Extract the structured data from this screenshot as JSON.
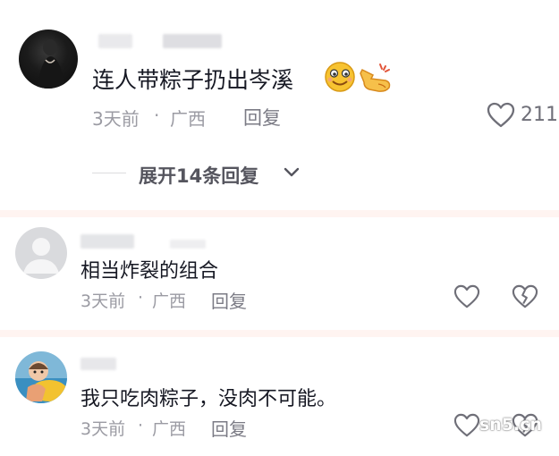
{
  "comments": [
    {
      "text": "连人带粽子扔出岑溪",
      "time": "3天前",
      "location": "广西",
      "reply_label": "回复",
      "like_count": "211",
      "expand_label": "展开14条回复"
    },
    {
      "text": "相当炸裂的组合",
      "time": "3天前",
      "location": "广西",
      "reply_label": "回复"
    },
    {
      "text": "我只吃肉粽子，没肉不可能。",
      "time": "3天前",
      "location": "广西",
      "reply_label": "回复"
    }
  ],
  "dot": "·",
  "watermark": "sn5.cn",
  "icons": {
    "emoji_1": "smiling-face-emoji",
    "emoji_2": "hand-emoji",
    "like": "heart-icon",
    "dislike": "broken-heart-icon",
    "expand": "chevron-down-icon"
  },
  "colors": {
    "divider": "#fff4f1",
    "meta": "#9b9ba3",
    "text": "#161823"
  }
}
